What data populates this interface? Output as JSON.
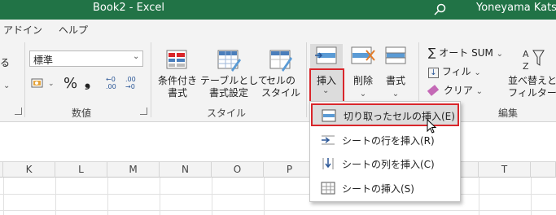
{
  "window": {
    "title": "Book2 - Excel",
    "user": "Yoneyama Katsu"
  },
  "menu_tabs": [
    "アドイン",
    "ヘルプ"
  ],
  "ribbon": {
    "left_partial": "る",
    "number": {
      "format_value": "標準",
      "percent": "%",
      "comma": "❟",
      "inc_decimal": "←0\n.00",
      "dec_decimal": ".00\n→0",
      "group_label": "数値"
    },
    "styles": {
      "conditional_formatting": [
        "条件付き",
        "書式"
      ],
      "format_as_table": [
        "テーブルとして",
        "書式設定"
      ],
      "cell_styles": [
        "セルの",
        "スタイル"
      ],
      "group_label": "スタイル"
    },
    "cells": {
      "insert": "挿入",
      "delete": "削除",
      "format": "書式"
    },
    "editing": {
      "autosum": "オート SUM",
      "fill": "フィル",
      "clear": "クリア",
      "sort_filter": [
        "並べ替えと",
        "フィルター"
      ],
      "group_label": "編集"
    }
  },
  "columns": [
    "K",
    "L",
    "M",
    "N",
    "O",
    "P",
    "T"
  ],
  "insert_menu": {
    "items": [
      "切り取ったセルの挿入(E)",
      "シートの行を挿入(R)",
      "シートの列を挿入(C)",
      "シートの挿入(S)"
    ],
    "highlighted_index": 0
  },
  "colors": {
    "titlebar": "#217346",
    "accent_red": "#d9262b",
    "highlight": "#dcdcdc"
  }
}
